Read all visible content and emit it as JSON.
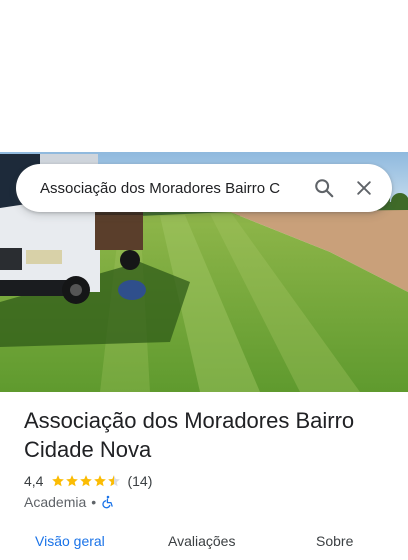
{
  "search": {
    "query": "Associação dos Moradores Bairro C"
  },
  "place": {
    "title": "Associação dos Moradores Bairro Cidade Nova",
    "rating": "4,4",
    "rating_value": 4.4,
    "stars_filled": 4.5,
    "review_count": "(14)",
    "category": "Academia",
    "separator": "•",
    "accessibility_icon": "wheelchair-icon"
  },
  "tabs": [
    {
      "label": "Visão geral",
      "active": true
    },
    {
      "label": "Avaliações",
      "active": false
    },
    {
      "label": "Sobre",
      "active": false
    }
  ],
  "colors": {
    "star": "#fbbc04",
    "accent": "#1a73e8",
    "accessibility": "#1a73e8"
  }
}
